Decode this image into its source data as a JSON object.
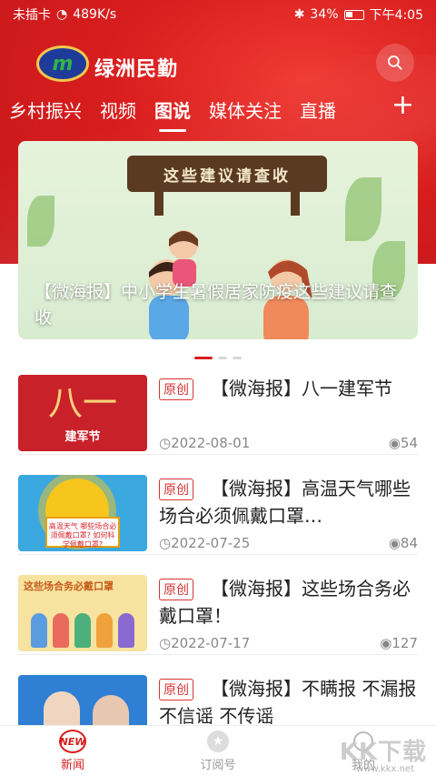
{
  "status_bar": {
    "carrier": "未插卡",
    "speed": "489K/s",
    "battery": "34%",
    "time": "下午4:05"
  },
  "header": {
    "brand": "绿洲民勤",
    "logo_letter": "m"
  },
  "tabs": [
    {
      "label": "乡村振兴",
      "active": false
    },
    {
      "label": "视频",
      "active": false
    },
    {
      "label": "图说",
      "active": true
    },
    {
      "label": "媒体关注",
      "active": false
    },
    {
      "label": "直播",
      "active": false
    }
  ],
  "tab_add": "+",
  "banner": {
    "sign_text": "这些建议请查收",
    "caption": "【微海报】中小学生暑假居家防疫这些建议请查收"
  },
  "news": [
    {
      "badge": "原创",
      "title": "【微海报】八一建军节",
      "date": "2022-08-01",
      "views": "54",
      "thumb": {
        "big": "八一",
        "small": "建军节"
      }
    },
    {
      "badge": "原创",
      "title": "【微海报】高温天气哪些场合必须佩戴口罩…",
      "date": "2022-07-25",
      "views": "84",
      "thumb": {
        "text": "高温天气 哪些场合必须佩戴口罩? 如何科学佩戴口罩?"
      }
    },
    {
      "badge": "原创",
      "title": "【微海报】这些场合务必戴口罩！",
      "date": "2022-07-17",
      "views": "127",
      "thumb": {
        "text": "这些场合务必戴口罩"
      }
    },
    {
      "badge": "原创",
      "title": "【微海报】不瞒报 不漏报 不信谣 不传谣",
      "date": "",
      "views": "",
      "thumb": {}
    }
  ],
  "bottom_nav": [
    {
      "label": "新闻",
      "icon": "new-icon",
      "icon_text": "NEW",
      "active": true
    },
    {
      "label": "订阅号",
      "icon": "star-icon",
      "active": false
    },
    {
      "label": "我的",
      "icon": "person-icon",
      "active": false
    }
  ],
  "watermark": {
    "text": "KK下载",
    "sub": "www.kkx.net"
  },
  "colors": {
    "brand_red": "#d81e1e",
    "badge_red": "#d83232"
  }
}
